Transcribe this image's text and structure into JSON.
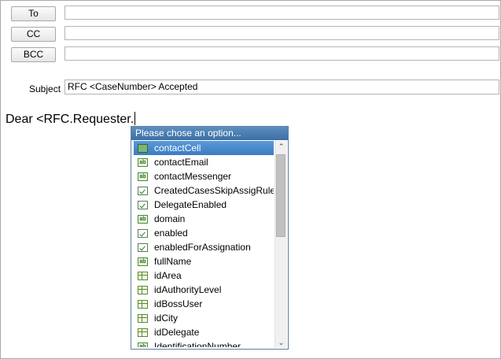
{
  "compose": {
    "to_label": "To",
    "cc_label": "CC",
    "bcc_label": "BCC",
    "subject_label": "Subject",
    "subject_value": "RFC <CaseNumber> Accepted",
    "body_text": "Dear <RFC.Requester."
  },
  "autocomplete": {
    "header": "Please chose an option...",
    "items": [
      {
        "label": "contactCell",
        "icon": "cell-icon",
        "selected": true
      },
      {
        "label": "contactEmail",
        "icon": "text-field-icon"
      },
      {
        "label": "contactMessenger",
        "icon": "text-field-icon"
      },
      {
        "label": "CreatedCasesSkipAssigRules",
        "icon": "checkbox-icon"
      },
      {
        "label": "DelegateEnabled",
        "icon": "checkbox-icon"
      },
      {
        "label": "domain",
        "icon": "text-field-icon"
      },
      {
        "label": "enabled",
        "icon": "checkbox-icon"
      },
      {
        "label": "enabledForAssignation",
        "icon": "checkbox-icon"
      },
      {
        "label": "fullName",
        "icon": "text-field-icon"
      },
      {
        "label": "idArea",
        "icon": "table-icon"
      },
      {
        "label": "idAuthorityLevel",
        "icon": "table-icon"
      },
      {
        "label": "idBossUser",
        "icon": "table-icon"
      },
      {
        "label": "idCity",
        "icon": "table-icon"
      },
      {
        "label": "idDelegate",
        "icon": "table-icon"
      },
      {
        "label": "IdentificationNumber",
        "icon": "text-field-icon"
      }
    ],
    "scroll_up_glyph": "⌃",
    "scroll_down_glyph": "⌄",
    "text_icon_glyph": "ab"
  }
}
